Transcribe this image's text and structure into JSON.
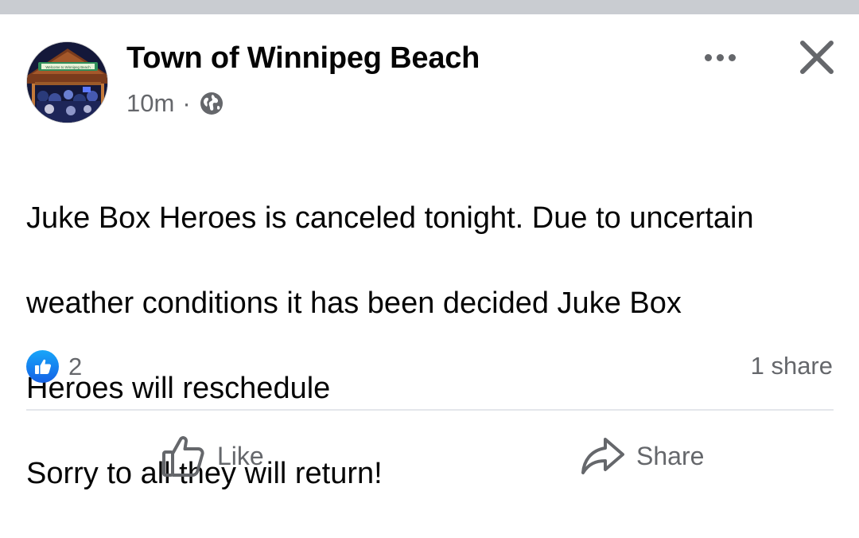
{
  "post": {
    "author": "Town of Winnipeg Beach",
    "timestamp": "10m",
    "separator": "·",
    "audience_icon": "globe-icon",
    "avatar_sign_text": "Welcome to Winnipeg Beach",
    "text_lines": [
      "Juke Box Heroes is canceled tonight. Due to uncertain",
      "weather conditions it  has been decided Juke Box",
      "Heroes will reschedule",
      "Sorry to all they will return!"
    ]
  },
  "engagement": {
    "reaction_icon": "like-reaction-icon",
    "reaction_count": "2",
    "share_count": "1 share"
  },
  "actions": {
    "like_label": "Like",
    "share_label": "Share"
  },
  "header": {
    "more_icon": "more-options-icon",
    "close_icon": "close-icon"
  },
  "colors": {
    "text_primary": "#050505",
    "text_secondary": "#65676b",
    "like_blue": "#1877f2",
    "divider": "#e4e6eb"
  }
}
